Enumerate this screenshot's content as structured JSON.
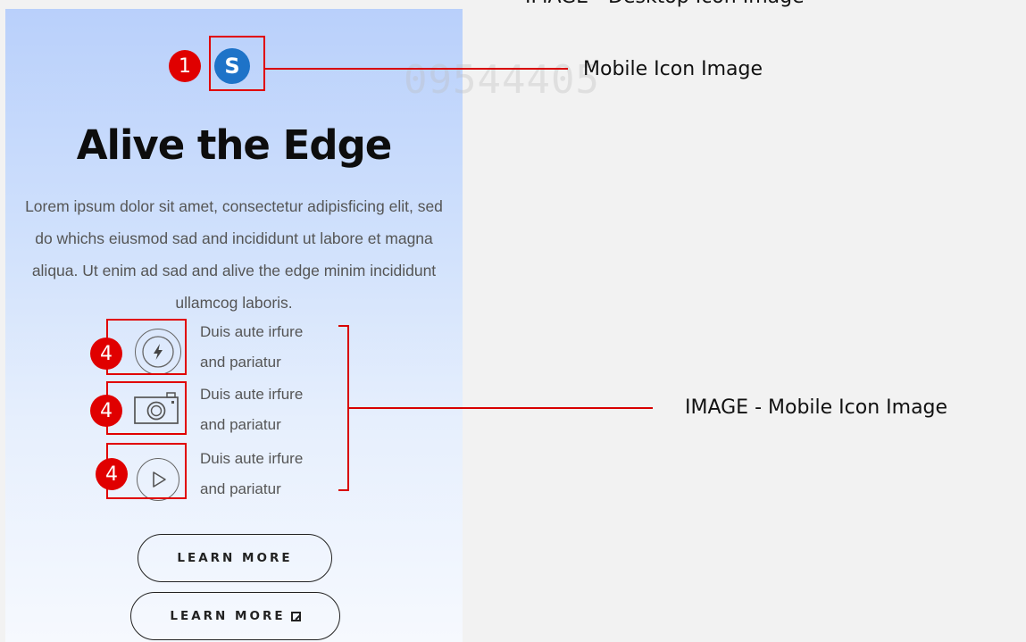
{
  "captions": {
    "top": "IMAGE - Desktop Icon Image",
    "mobile_icon": "Mobile Icon Image",
    "mobile_icon_image": "IMAGE - Mobile Icon Image"
  },
  "watermark": "09544405",
  "page": {
    "brand_icon_letter": "S",
    "headline": "Alive the Edge",
    "body": "Lorem ipsum dolor sit amet, consectetur adipisficing elit, sed do whichs eiusmod sad and incididunt ut labore et magna aliqua. Ut enim ad sad and alive the edge minim incididunt ullamcog laboris.",
    "features": [
      {
        "icon": "lightning-icon",
        "line1": "Duis aute irfure",
        "line2": "and pariatur"
      },
      {
        "icon": "camera-icon",
        "line1": "Duis aute irfure",
        "line2": "and pariatur"
      },
      {
        "icon": "play-icon",
        "line1": "Duis aute irfure",
        "line2": "and pariatur"
      }
    ],
    "buttons": {
      "learn_more": "LEARN MORE",
      "learn_more_external": "LEARN MORE"
    }
  },
  "markers": {
    "first": "1",
    "feature": "4"
  },
  "colors": {
    "annotation_red": "#e00000",
    "brand_blue": "#1e73c8"
  }
}
